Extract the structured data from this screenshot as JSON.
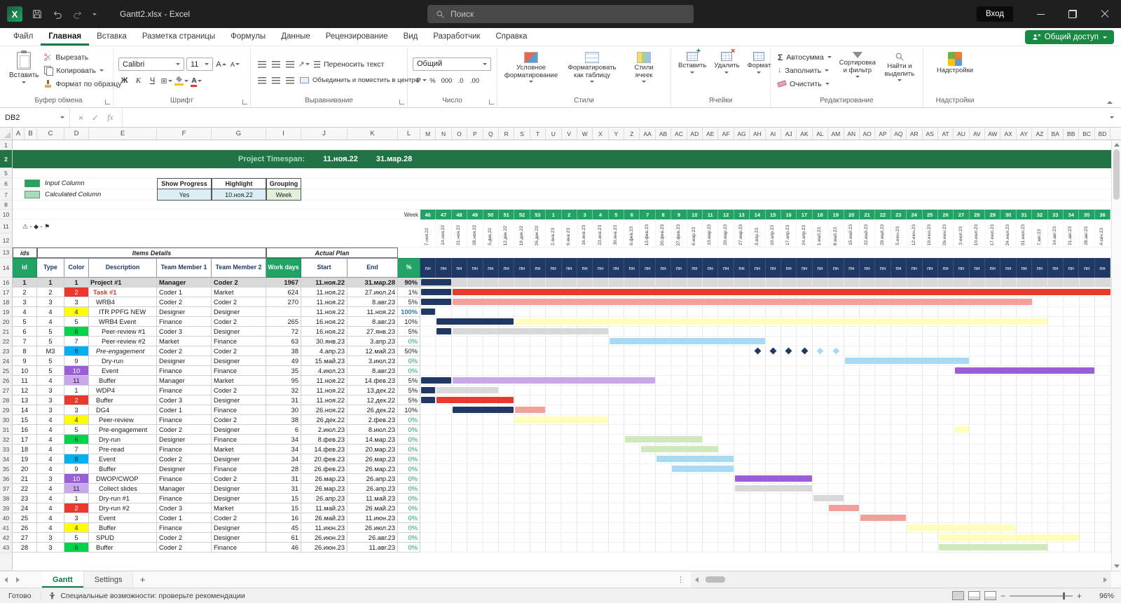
{
  "titlebar": {
    "title": "Gantt2.xlsx - Excel",
    "search_placeholder": "Поиск",
    "signin_label": "Вход"
  },
  "ribbon": {
    "tabs": [
      "Файл",
      "Главная",
      "Вставка",
      "Разметка страницы",
      "Формулы",
      "Данные",
      "Рецензирование",
      "Вид",
      "Разработчик",
      "Справка"
    ],
    "active_tab": "Главная",
    "share_label": "Общий доступ",
    "clipboard": {
      "label": "Буфер обмена",
      "paste": "Вставить",
      "cut": "Вырезать",
      "copy": "Копировать",
      "painter": "Формат по образцу"
    },
    "font": {
      "label": "Шрифт",
      "name": "Calibri",
      "size": "11",
      "bold": "Ж",
      "italic": "К",
      "underline": "Ч",
      "letter": "А"
    },
    "alignment": {
      "label": "Выравнивание",
      "wrap": "Переносить текст",
      "merge": "Объединить и поместить в центре"
    },
    "number": {
      "label": "Число",
      "format": "Общий",
      "buttons": [
        "₽",
        "%",
        "000",
        ".0",
        ".00"
      ]
    },
    "styles": {
      "label": "Стили",
      "conditional": "Условное форматирование",
      "as_table": "Форматировать как таблицу",
      "cell_styles": "Стили ячеек"
    },
    "cells": {
      "label": "Ячейки",
      "insert": "Вставить",
      "del": "Удалить",
      "format": "Формат"
    },
    "editing": {
      "label": "Редактирование",
      "autosum": "Автосумма",
      "fill": "Заполнить",
      "clear": "Очистить",
      "sort": "Сортировка и фильтр",
      "find": "Найти и выделить"
    },
    "addins": {
      "label": "Надстройки",
      "button": "Надстройки"
    }
  },
  "formula_bar": {
    "name_box": "DB2",
    "cancel": "×",
    "enter": "✓",
    "fx": "fx"
  },
  "sheet": {
    "left_col_letters": [
      "A",
      "B",
      "C",
      "D",
      "E",
      "F",
      "G",
      "I",
      "J",
      "K",
      "L"
    ],
    "gantt_col_letters": [
      "M",
      "N",
      "O",
      "P",
      "Q",
      "R",
      "S",
      "T",
      "U",
      "V",
      "W",
      "X",
      "Y",
      "Z",
      "AA",
      "AB",
      "AC",
      "AD",
      "AE",
      "AF",
      "AG",
      "AH",
      "AI",
      "AJ",
      "AK",
      "AL",
      "AM",
      "AN",
      "AO",
      "AP",
      "AQ",
      "AR",
      "AS",
      "AT",
      "AU",
      "AV",
      "AW",
      "AX",
      "AY",
      "AZ",
      "BA",
      "BB",
      "BC",
      "BD"
    ],
    "row_numbers_top": [
      "1",
      "2",
      "5",
      "6",
      "7",
      "8",
      "10"
    ],
    "row_numbers_dates": [
      "11",
      "12"
    ],
    "row_numbers_mid": [
      "13",
      "14"
    ],
    "banner": {
      "label": "Project Timespan:",
      "start": "11.ноя.22",
      "end": "31.мар.28"
    },
    "legend": {
      "input": "Input Column",
      "calculated": "Calculated Column"
    },
    "options": {
      "headers": [
        "Show Progress",
        "Highlight",
        "Grouping"
      ],
      "values": [
        "Yes",
        "10.ноя.22",
        "Week"
      ]
    },
    "symbols_note": "⚠ - ◆ - ⚑",
    "week_label": "Week",
    "weeks": [
      "46",
      "47",
      "48",
      "49",
      "50",
      "51",
      "52",
      "53",
      "1",
      "2",
      "3",
      "4",
      "5",
      "6",
      "7",
      "8",
      "9",
      "10",
      "11",
      "12",
      "13",
      "14",
      "15",
      "16",
      "17",
      "18",
      "19",
      "20",
      "21",
      "22",
      "23",
      "24",
      "25",
      "26",
      "27",
      "28",
      "29",
      "30",
      "31",
      "32",
      "33",
      "34",
      "35",
      "36"
    ],
    "week_dates": [
      "7.ноя.22",
      "14.ноя.22",
      "21.ноя.22",
      "28.ноя.22",
      "5.дек.22",
      "12.дек.22",
      "19.дек.22",
      "26.дек.22",
      "2.янв.23",
      "9.янв.23",
      "16.янв.23",
      "23.янв.23",
      "30.янв.23",
      "6.фев.23",
      "13.фев.23",
      "20.фев.23",
      "27.фев.23",
      "6.мар.23",
      "13.мар.23",
      "20.мар.23",
      "27.мар.23",
      "3.апр.23",
      "10.апр.23",
      "17.апр.23",
      "24.апр.23",
      "1.май.23",
      "8.май.23",
      "15.май.23",
      "22.май.23",
      "29.май.23",
      "5.июн.23",
      "12.июн.23",
      "19.июн.23",
      "26.июн.23",
      "3.июл.23",
      "10.июл.23",
      "17.июл.23",
      "24.июл.23",
      "31.июл.23",
      "7.авг.23",
      "14.авг.23",
      "21.авг.23",
      "28.авг.23",
      "4.сен.23"
    ],
    "weekday": "пн",
    "table_headers": {
      "ids": "ids",
      "items": "Items Details",
      "plan": "Actual Plan",
      "cols": [
        "id",
        "Type",
        "Color",
        "Description",
        "Team Member 1",
        "Team Member 2",
        "Work days",
        "Start",
        "End",
        "%"
      ]
    },
    "rows": [
      {
        "n": "16",
        "id": "1",
        "type": "1",
        "cnum": "1",
        "desc": "Project #1",
        "tm1": "Manager",
        "tm2": "Coder 2",
        "days": "1967",
        "start": "11.ноя.22",
        "end": "31.мар.28",
        "pct": "90%",
        "bold": true,
        "bars": [
          [
            0,
            2,
            "navy"
          ]
        ]
      },
      {
        "n": "17",
        "id": "2",
        "type": "2",
        "cnum": "2",
        "desc": "Task #1",
        "tm1": "Coder 1",
        "tm2": "Market",
        "days": "624",
        "start": "11.ноя.22",
        "end": "27.июл.24",
        "pct": "1%",
        "descRed": true,
        "bars": [
          [
            0,
            2,
            "navy"
          ],
          [
            2,
            44,
            "red"
          ]
        ]
      },
      {
        "n": "18",
        "id": "3",
        "type": "3",
        "cnum": "3",
        "desc": "WRB4",
        "tm1": "Coder 2",
        "tm2": "Coder 2",
        "days": "270",
        "start": "11.ноя.22",
        "end": "8.авг.23",
        "pct": "5%",
        "bars": [
          [
            0,
            2,
            "navy"
          ],
          [
            2,
            39,
            "salmon"
          ]
        ]
      },
      {
        "n": "19",
        "id": "4",
        "type": "4",
        "cnum": "4",
        "desc": "ITR PPFG NEW",
        "tm1": "Designer",
        "tm2": "Designer",
        "days": "",
        "start": "11.ноя.22",
        "end": "11.ноя.22",
        "pct": "100%",
        "bars": [
          [
            0,
            1,
            "navy"
          ]
        ]
      },
      {
        "n": "20",
        "id": "5",
        "type": "4",
        "cnum": "5",
        "desc": "WRB4 Event",
        "tm1": "Finance",
        "tm2": "Coder 2",
        "days": "265",
        "start": "16.ноя.22",
        "end": "8.авг.23",
        "pct": "10%",
        "bars": [
          [
            1,
            6,
            "navy"
          ],
          [
            6,
            40,
            "py"
          ]
        ]
      },
      {
        "n": "21",
        "id": "6",
        "type": "5",
        "cnum": "6",
        "desc": "Peer-review #1",
        "tm1": "Coder 3",
        "tm2": "Designer",
        "days": "72",
        "start": "16.ноя.22",
        "end": "27.янв.23",
        "pct": "5%",
        "bars": [
          [
            1,
            2,
            "navy"
          ],
          [
            2,
            12,
            "gy"
          ]
        ]
      },
      {
        "n": "22",
        "id": "7",
        "type": "5",
        "cnum": "7",
        "desc": "Peer-review #2",
        "tm1": "Market",
        "tm2": "Finance",
        "days": "63",
        "start": "30.янв.23",
        "end": "3.апр.23",
        "pct": "0%",
        "bars": [
          [
            12,
            22,
            "lb"
          ]
        ]
      },
      {
        "n": "23",
        "id": "8",
        "type": "M3",
        "cnum": "8",
        "desc": "Pre-engagement",
        "tm1": "Coder 2",
        "tm2": "Coder 2",
        "days": "38",
        "start": "4.апр.23",
        "end": "12.май.23",
        "pct": "50%",
        "italic": true,
        "diamonds": [
          [
            21,
            "navy"
          ],
          [
            22,
            "navy"
          ],
          [
            23,
            "navy"
          ],
          [
            24,
            "navy"
          ],
          [
            25,
            "lb"
          ],
          [
            26,
            "lb"
          ]
        ]
      },
      {
        "n": "24",
        "id": "9",
        "type": "5",
        "cnum": "9",
        "desc": "Dry-run",
        "tm1": "Designer",
        "tm2": "Designer",
        "days": "49",
        "start": "15.май.23",
        "end": "3.июл.23",
        "pct": "0%",
        "bars": [
          [
            27,
            35,
            "lb"
          ]
        ]
      },
      {
        "n": "25",
        "id": "10",
        "type": "5",
        "cnum": "10",
        "desc": "Event",
        "tm1": "Finance",
        "tm2": "Finance",
        "days": "35",
        "start": "4.июл.23",
        "end": "8.авг.23",
        "pct": "0%",
        "bars": [
          [
            34,
            43,
            "pu"
          ]
        ]
      },
      {
        "n": "26",
        "id": "11",
        "type": "4",
        "cnum": "11",
        "desc": "Buffer",
        "tm1": "Manager",
        "tm2": "Market",
        "days": "95",
        "start": "11.ноя.22",
        "end": "14.фев.23",
        "pct": "5%",
        "bars": [
          [
            0,
            2,
            "navy"
          ],
          [
            2,
            15,
            "lpu"
          ]
        ]
      },
      {
        "n": "27",
        "id": "12",
        "type": "3",
        "cnum": "1",
        "desc": "WDP4",
        "tm1": "Finance",
        "tm2": "Coder 2",
        "days": "32",
        "start": "11.ноя.22",
        "end": "13.дек.22",
        "pct": "5%",
        "bars": [
          [
            0,
            1,
            "navy"
          ],
          [
            1,
            5,
            "gy"
          ]
        ]
      },
      {
        "n": "28",
        "id": "13",
        "type": "3",
        "cnum": "2",
        "desc": "Buffer",
        "tm1": "Coder 3",
        "tm2": "Designer",
        "days": "31",
        "start": "11.ноя.22",
        "end": "12.дек.22",
        "pct": "5%",
        "bars": [
          [
            0,
            1,
            "navy"
          ],
          [
            1,
            6,
            "red"
          ]
        ]
      },
      {
        "n": "29",
        "id": "14",
        "type": "3",
        "cnum": "3",
        "desc": "DG4",
        "tm1": "Coder 1",
        "tm2": "Finance",
        "days": "30",
        "start": "26.ноя.22",
        "end": "26.дек.22",
        "pct": "10%",
        "bars": [
          [
            2,
            6,
            "navy"
          ],
          [
            6,
            8,
            "salmon"
          ]
        ]
      },
      {
        "n": "30",
        "id": "15",
        "type": "4",
        "cnum": "4",
        "desc": "Peer-review",
        "tm1": "Finance",
        "tm2": "Coder 2",
        "days": "38",
        "start": "26.дек.22",
        "end": "2.фев.23",
        "pct": "0%",
        "bars": [
          [
            6,
            12,
            "py"
          ]
        ]
      },
      {
        "n": "31",
        "id": "16",
        "type": "4",
        "cnum": "5",
        "desc": "Pre-engagement",
        "tm1": "Coder 2",
        "tm2": "Designer",
        "days": "6",
        "start": "2.июл.23",
        "end": "8.июл.23",
        "pct": "0%",
        "bars": [
          [
            34,
            35,
            "py"
          ]
        ]
      },
      {
        "n": "32",
        "id": "17",
        "type": "4",
        "cnum": "6",
        "desc": "Dry-run",
        "tm1": "Designer",
        "tm2": "Finance",
        "days": "34",
        "start": "8.фев.23",
        "end": "14.мар.23",
        "pct": "0%",
        "bars": [
          [
            13,
            18,
            "pg"
          ]
        ]
      },
      {
        "n": "33",
        "id": "18",
        "type": "4",
        "cnum": "7",
        "desc": "Pre-read",
        "tm1": "Finance",
        "tm2": "Market",
        "days": "34",
        "start": "14.фев.23",
        "end": "20.мар.23",
        "pct": "0%",
        "bars": [
          [
            14,
            19,
            "pg"
          ]
        ]
      },
      {
        "n": "34",
        "id": "19",
        "type": "4",
        "cnum": "8",
        "desc": "Event",
        "tm1": "Coder 2",
        "tm2": "Designer",
        "days": "34",
        "start": "20.фев.23",
        "end": "26.мар.23",
        "pct": "0%",
        "bars": [
          [
            15,
            20,
            "lb"
          ]
        ]
      },
      {
        "n": "35",
        "id": "20",
        "type": "4",
        "cnum": "9",
        "desc": "Buffer",
        "tm1": "Designer",
        "tm2": "Finance",
        "days": "28",
        "start": "26.фев.23",
        "end": "26.мар.23",
        "pct": "0%",
        "bars": [
          [
            16,
            20,
            "lb"
          ]
        ]
      },
      {
        "n": "36",
        "id": "21",
        "type": "3",
        "cnum": "10",
        "desc": "DWOP/CWOP",
        "tm1": "Finance",
        "tm2": "Coder 2",
        "days": "31",
        "start": "26.мар.23",
        "end": "26.апр.23",
        "pct": "0%",
        "bars": [
          [
            20,
            25,
            "pu"
          ]
        ]
      },
      {
        "n": "37",
        "id": "22",
        "type": "4",
        "cnum": "11",
        "desc": "Collect slides",
        "tm1": "Manager",
        "tm2": "Designer",
        "days": "31",
        "start": "26.мар.23",
        "end": "26.апр.23",
        "pct": "0%",
        "bars": [
          [
            20,
            25,
            "gy"
          ]
        ]
      },
      {
        "n": "38",
        "id": "23",
        "type": "4",
        "cnum": "1",
        "desc": "Dry-run #1",
        "tm1": "Finance",
        "tm2": "Designer",
        "days": "15",
        "start": "26.апр.23",
        "end": "11.май.23",
        "pct": "0%",
        "bars": [
          [
            25,
            27,
            "gy"
          ]
        ]
      },
      {
        "n": "39",
        "id": "24",
        "type": "4",
        "cnum": "2",
        "desc": "Dry-run #2",
        "tm1": "Coder 3",
        "tm2": "Market",
        "days": "15",
        "start": "11.май.23",
        "end": "26.май.23",
        "pct": "0%",
        "bars": [
          [
            26,
            28,
            "salmon"
          ]
        ]
      },
      {
        "n": "40",
        "id": "25",
        "type": "4",
        "cnum": "3",
        "desc": "Event",
        "tm1": "Coder 1",
        "tm2": "Coder 2",
        "days": "16",
        "start": "26.май.23",
        "end": "11.июн.23",
        "pct": "0%",
        "bars": [
          [
            28,
            31,
            "salmon"
          ]
        ]
      },
      {
        "n": "41",
        "id": "26",
        "type": "4",
        "cnum": "4",
        "desc": "Buffer",
        "tm1": "Finance",
        "tm2": "Designer",
        "days": "45",
        "start": "11.июн.23",
        "end": "26.июл.23",
        "pct": "0%",
        "bars": [
          [
            31,
            38,
            "py"
          ]
        ]
      },
      {
        "n": "42",
        "id": "27",
        "type": "3",
        "cnum": "5",
        "desc": "SPUD",
        "tm1": "Coder 2",
        "tm2": "Designer",
        "days": "61",
        "start": "26.июн.23",
        "end": "26.авг.23",
        "pct": "0%",
        "bars": [
          [
            33,
            42,
            "py"
          ]
        ]
      },
      {
        "n": "43",
        "id": "28",
        "type": "3",
        "cnum": "6",
        "desc": "Buffer",
        "tm1": "Coder 2",
        "tm2": "Finance",
        "days": "46",
        "start": "26.июн.23",
        "end": "11.авг.23",
        "pct": "0%",
        "bars": [
          [
            33,
            40,
            "pg"
          ]
        ]
      }
    ]
  },
  "sheet_tabs": {
    "tabs": [
      "Gantt",
      "Settings"
    ],
    "active": "Gantt",
    "add_label": "+"
  },
  "status_bar": {
    "mode": "Готово",
    "accessibility": "Специальные возможности: проверьте рекомендации",
    "zoom": "96%"
  },
  "colors": {
    "navy": "#1f3864",
    "red": "#e8392c",
    "salmon": "#f4a09a",
    "py": "#ffffb8",
    "pg": "#cfe9bd",
    "lb": "#a8daf4",
    "pu": "#9a5fd5",
    "lpu": "#c9a8e8",
    "gy": "#d8d8d8",
    "yellow": "#ffff00",
    "blue": "#00b0f0",
    "green": "#00d44d",
    "excel_green": "#107c41",
    "banner_green": "#217346",
    "week_green": "#21a366",
    "header_navy": "#1f3864"
  }
}
